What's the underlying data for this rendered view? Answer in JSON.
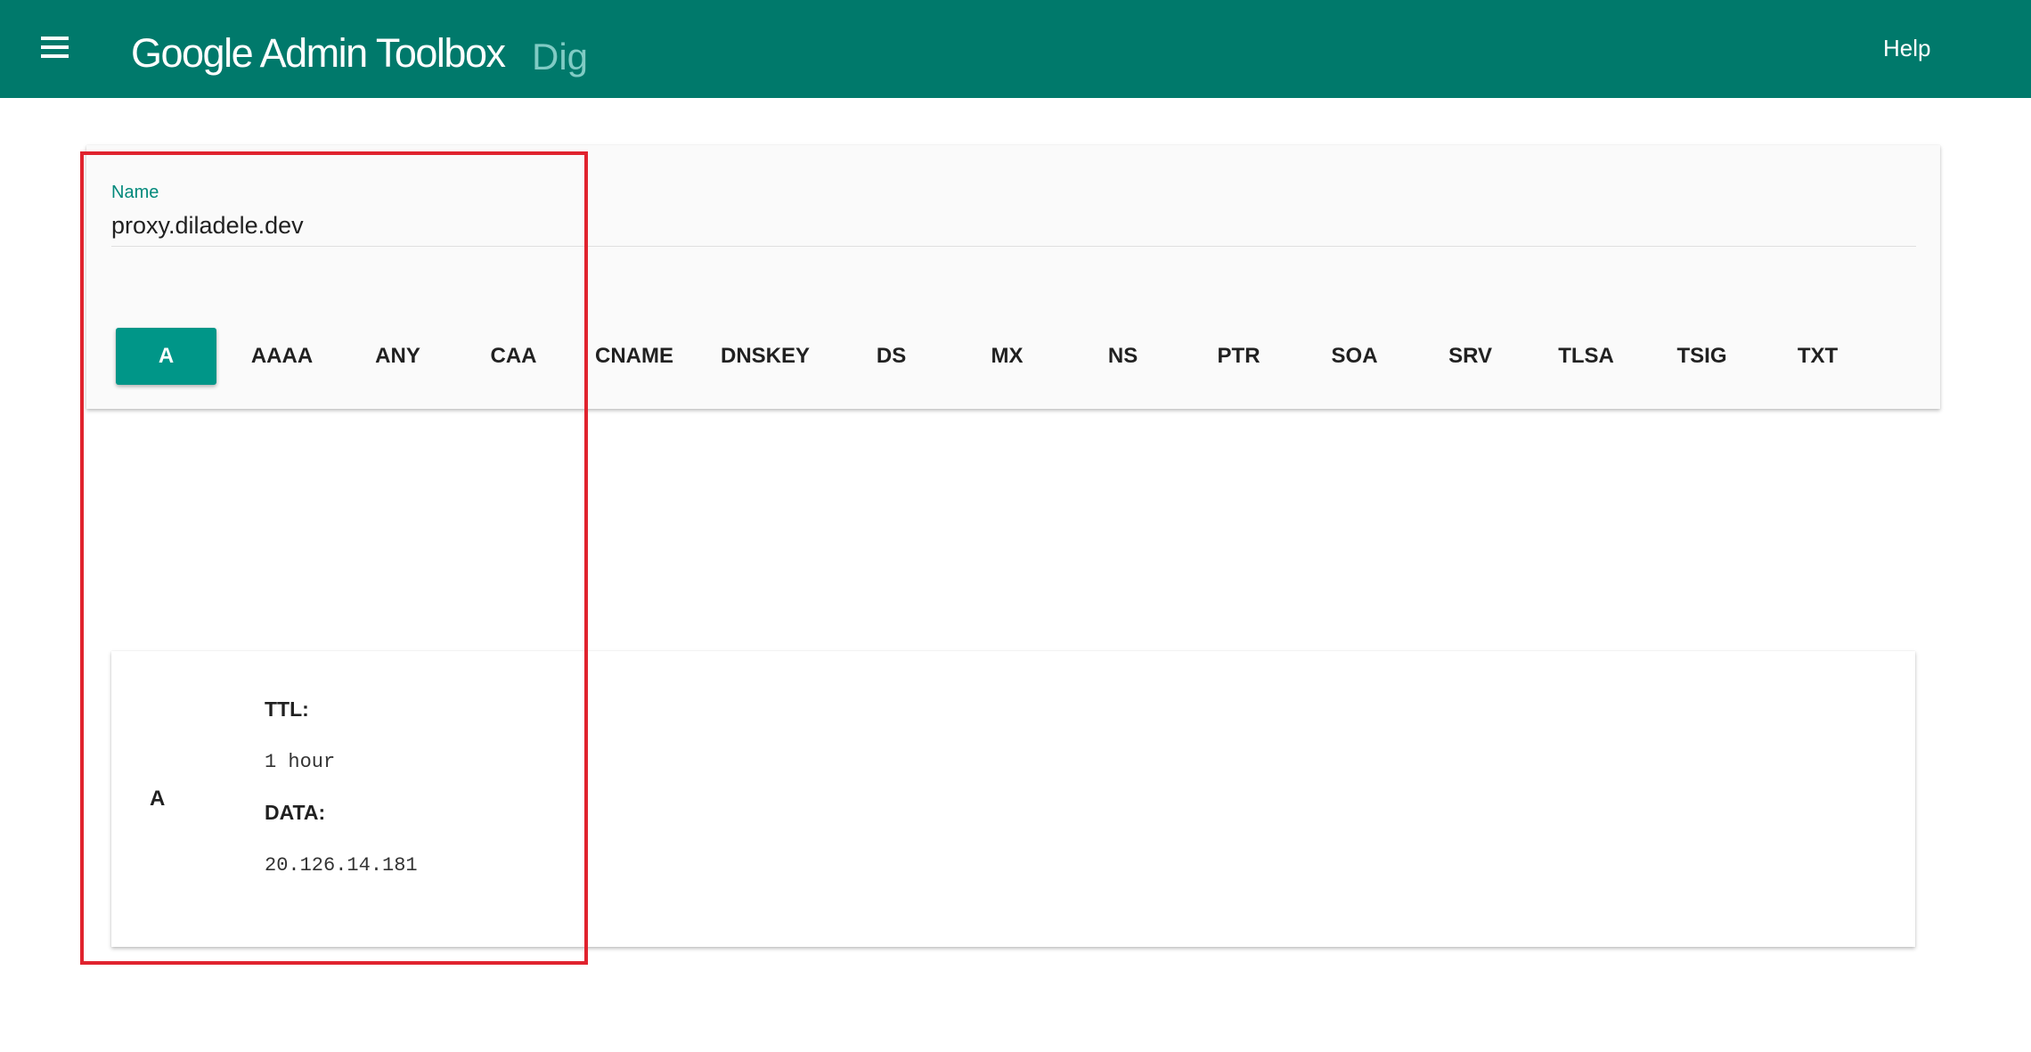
{
  "header": {
    "brand": "Google Admin Toolbox",
    "product": "Dig",
    "help_label": "Help",
    "menu_icon": "menu-icon"
  },
  "query": {
    "name_label": "Name",
    "name_value": "proxy.diladele.dev",
    "record_types": [
      "A",
      "AAAA",
      "ANY",
      "CAA",
      "CNAME",
      "DNSKEY",
      "DS",
      "MX",
      "NS",
      "PTR",
      "SOA",
      "SRV",
      "TLSA",
      "TSIG",
      "TXT"
    ],
    "selected_type": "A"
  },
  "result": {
    "type": "A",
    "ttl_label": "TTL:",
    "ttl_value": "1 hour",
    "data_label": "DATA:",
    "data_value": "20.126.14.181"
  },
  "colors": {
    "appbar": "#00796b",
    "accent": "#009688",
    "highlight": "#e0232e"
  }
}
